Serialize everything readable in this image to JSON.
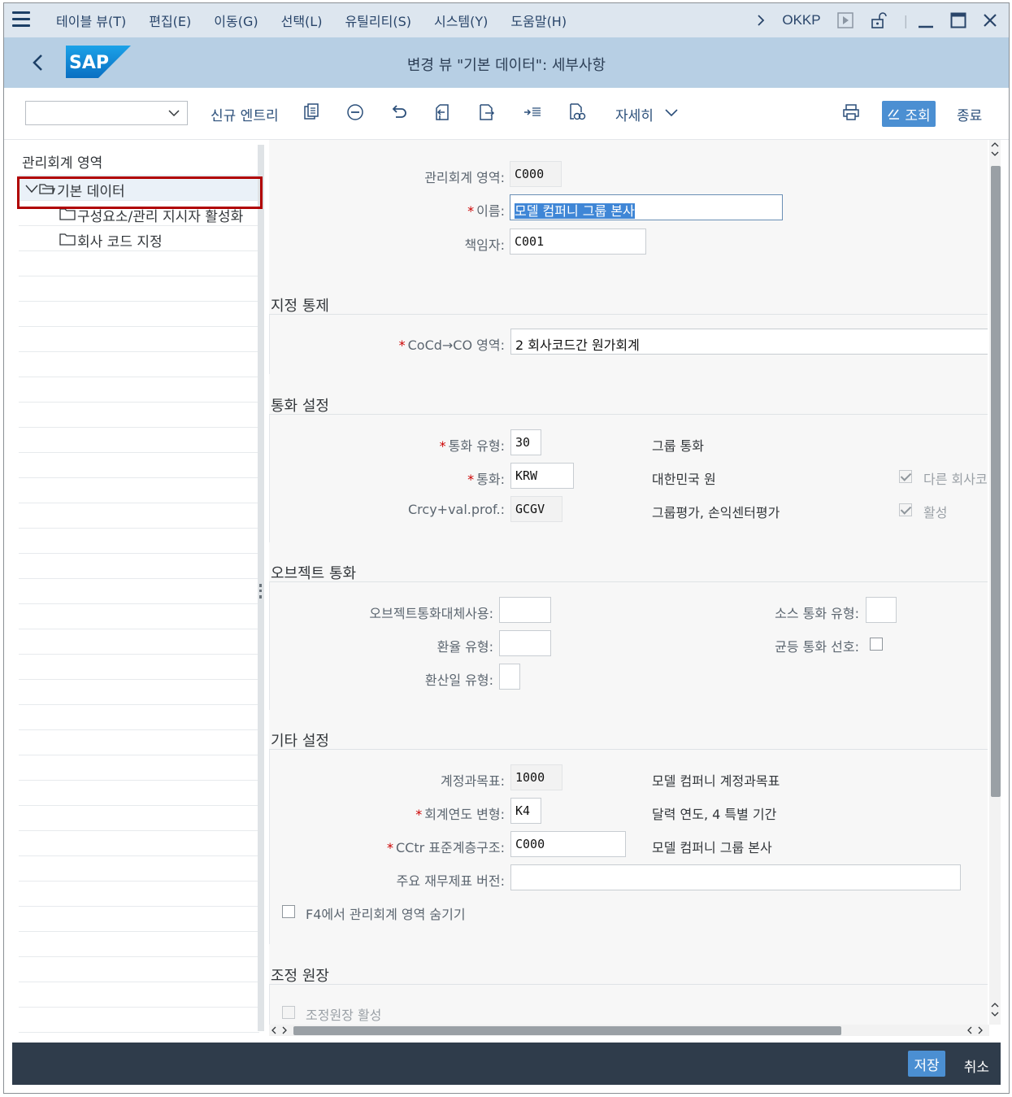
{
  "menubar": {
    "items": [
      "테이블 뷰(T)",
      "편집(E)",
      "이동(G)",
      "선택(L)",
      "유틸리티(S)",
      "시스템(Y)",
      "도움말(H)"
    ],
    "tcode": "OKKP"
  },
  "titlebar": {
    "title": "변경 뷰 \"기본 데이터\": 세부사항",
    "logo": "SAP"
  },
  "toolbar": {
    "dropdown_value": "",
    "new_entry": "신규 엔트리",
    "details": "자세히",
    "display": "조회",
    "exit": "종료"
  },
  "tree": {
    "header": "관리회계 영역",
    "items": [
      {
        "label": "기본 데이터",
        "selected": true
      },
      {
        "label": "구성요소/관리 지시자 활성화"
      },
      {
        "label": "회사 코드 지정"
      }
    ]
  },
  "form": {
    "co_area": {
      "label": "관리회계 영역:",
      "value": "C000"
    },
    "name": {
      "label": "이름:",
      "value": "모델 컴퍼니 그룹 본사"
    },
    "person": {
      "label": "책임자:",
      "value": "C001"
    },
    "assignment": {
      "title": "지정 통제",
      "cocd_label": "CoCd→CO 영역:",
      "cocd_value": "2 회사코드간 원가회계"
    },
    "currency": {
      "title": "통화 설정",
      "type_label": "통화 유형:",
      "type_value": "30",
      "type_desc": "그룹 통화",
      "curr_label": "통화:",
      "curr_value": "KRW",
      "curr_desc": "대한민국 원",
      "prof_label": "Crcy+val.prof.:",
      "prof_value": "GCGV",
      "prof_desc": "그룹평가, 손익센터평가",
      "check1_label": "다른 회사코",
      "check2_label": "활성"
    },
    "object_currency": {
      "title": "오브젝트 통화",
      "alt_label": "오브젝트통화대체사용:",
      "rate_label": "환율 유형:",
      "date_label": "환산일 유형:",
      "source_label": "소스 통화 유형:",
      "equal_label": "균등 통화 선호:"
    },
    "other": {
      "title": "기타 설정",
      "coa_label": "계정과목표:",
      "coa_value": "1000",
      "coa_desc": "모델 컴퍼니 계정과목표",
      "fy_label": "회계연도 변형:",
      "fy_value": "K4",
      "fy_desc": "달력 연도, 4 특별 기간",
      "cctr_label": "CCtr 표준계층구조:",
      "cctr_value": "C000",
      "cctr_desc": "모델 컴퍼니 그룹 본사",
      "fs_label": "주요 재무제표 버전:",
      "fs_value": "",
      "hide_label": "F4에서 관리회계 영역 숨기기"
    },
    "reconciliation": {
      "title": "조정 원장",
      "active_label": "조정원장 활성"
    }
  },
  "footer": {
    "save": "저장",
    "cancel": "취소"
  }
}
